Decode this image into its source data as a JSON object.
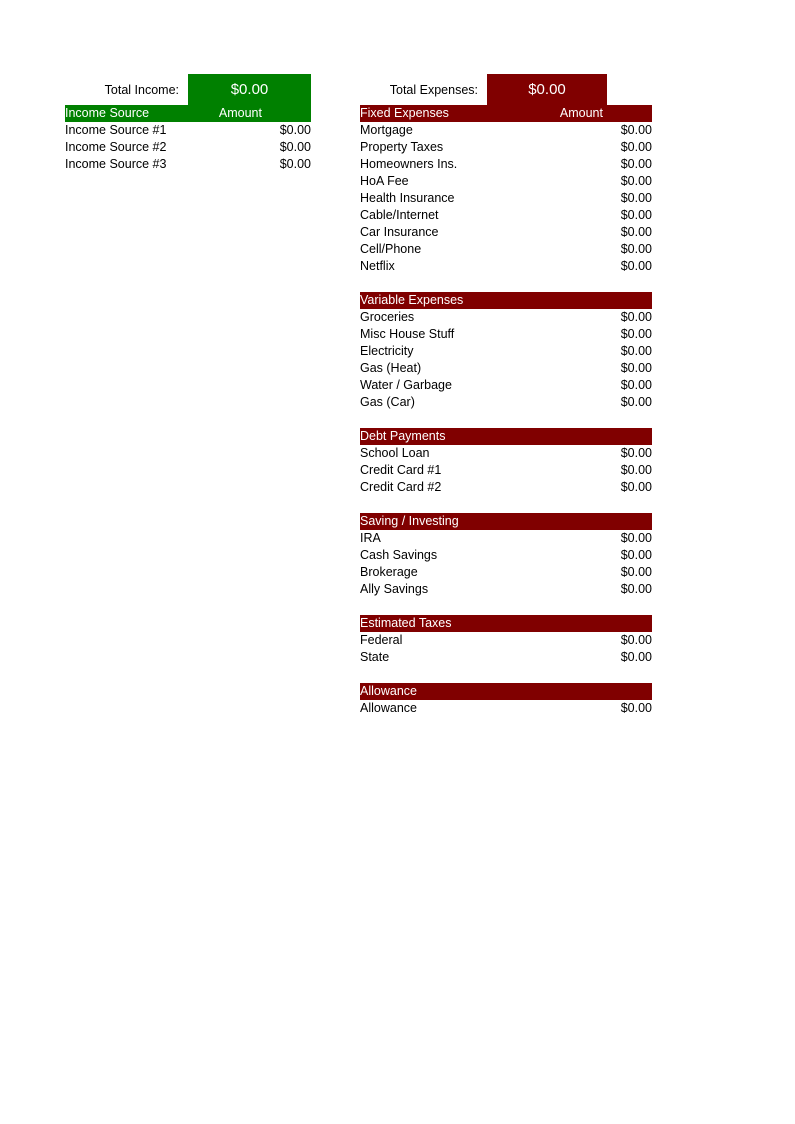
{
  "income": {
    "total_label": "Total Income:",
    "total_value": "$0.00",
    "accent_color": "#008000",
    "header": {
      "name": "Income Source",
      "amount": "Amount"
    },
    "rows": [
      {
        "name": "Income Source #1",
        "amount": "$0.00"
      },
      {
        "name": "Income Source #2",
        "amount": "$0.00"
      },
      {
        "name": "Income Source #3",
        "amount": "$0.00"
      }
    ]
  },
  "expenses": {
    "total_label": "Total Expenses:",
    "total_value": "$0.00",
    "accent_color": "#800000",
    "header": {
      "name": "Fixed Expenses",
      "amount": "Amount"
    },
    "sections": [
      {
        "title": "Fixed Expenses",
        "amount_header": "Amount",
        "rows": [
          {
            "name": "Mortgage",
            "amount": "$0.00"
          },
          {
            "name": "Property Taxes",
            "amount": "$0.00"
          },
          {
            "name": "Homeowners Ins.",
            "amount": "$0.00"
          },
          {
            "name": "HoA Fee",
            "amount": "$0.00"
          },
          {
            "name": "Health Insurance",
            "amount": "$0.00"
          },
          {
            "name": "Cable/Internet",
            "amount": "$0.00"
          },
          {
            "name": "Car Insurance",
            "amount": "$0.00"
          },
          {
            "name": "Cell/Phone",
            "amount": "$0.00"
          },
          {
            "name": "Netflix",
            "amount": "$0.00"
          }
        ]
      },
      {
        "title": "Variable Expenses",
        "amount_header": "",
        "rows": [
          {
            "name": "Groceries",
            "amount": "$0.00"
          },
          {
            "name": "Misc House Stuff",
            "amount": "$0.00"
          },
          {
            "name": "Electricity",
            "amount": "$0.00"
          },
          {
            "name": "Gas (Heat)",
            "amount": "$0.00"
          },
          {
            "name": "Water / Garbage",
            "amount": "$0.00"
          },
          {
            "name": "Gas (Car)",
            "amount": "$0.00"
          }
        ]
      },
      {
        "title": "Debt Payments",
        "amount_header": "",
        "rows": [
          {
            "name": "School Loan",
            "amount": "$0.00"
          },
          {
            "name": "Credit Card #1",
            "amount": "$0.00"
          },
          {
            "name": "Credit Card #2",
            "amount": "$0.00"
          }
        ]
      },
      {
        "title": "Saving / Investing",
        "amount_header": "",
        "rows": [
          {
            "name": "IRA",
            "amount": "$0.00"
          },
          {
            "name": "Cash Savings",
            "amount": "$0.00"
          },
          {
            "name": "Brokerage",
            "amount": "$0.00"
          },
          {
            "name": "Ally Savings",
            "amount": "$0.00"
          }
        ]
      },
      {
        "title": "Estimated Taxes",
        "amount_header": "",
        "rows": [
          {
            "name": "Federal",
            "amount": "$0.00"
          },
          {
            "name": "State",
            "amount": "$0.00"
          }
        ]
      },
      {
        "title": "Allowance",
        "amount_header": "",
        "rows": [
          {
            "name": "Allowance",
            "amount": "$0.00"
          }
        ]
      }
    ]
  }
}
